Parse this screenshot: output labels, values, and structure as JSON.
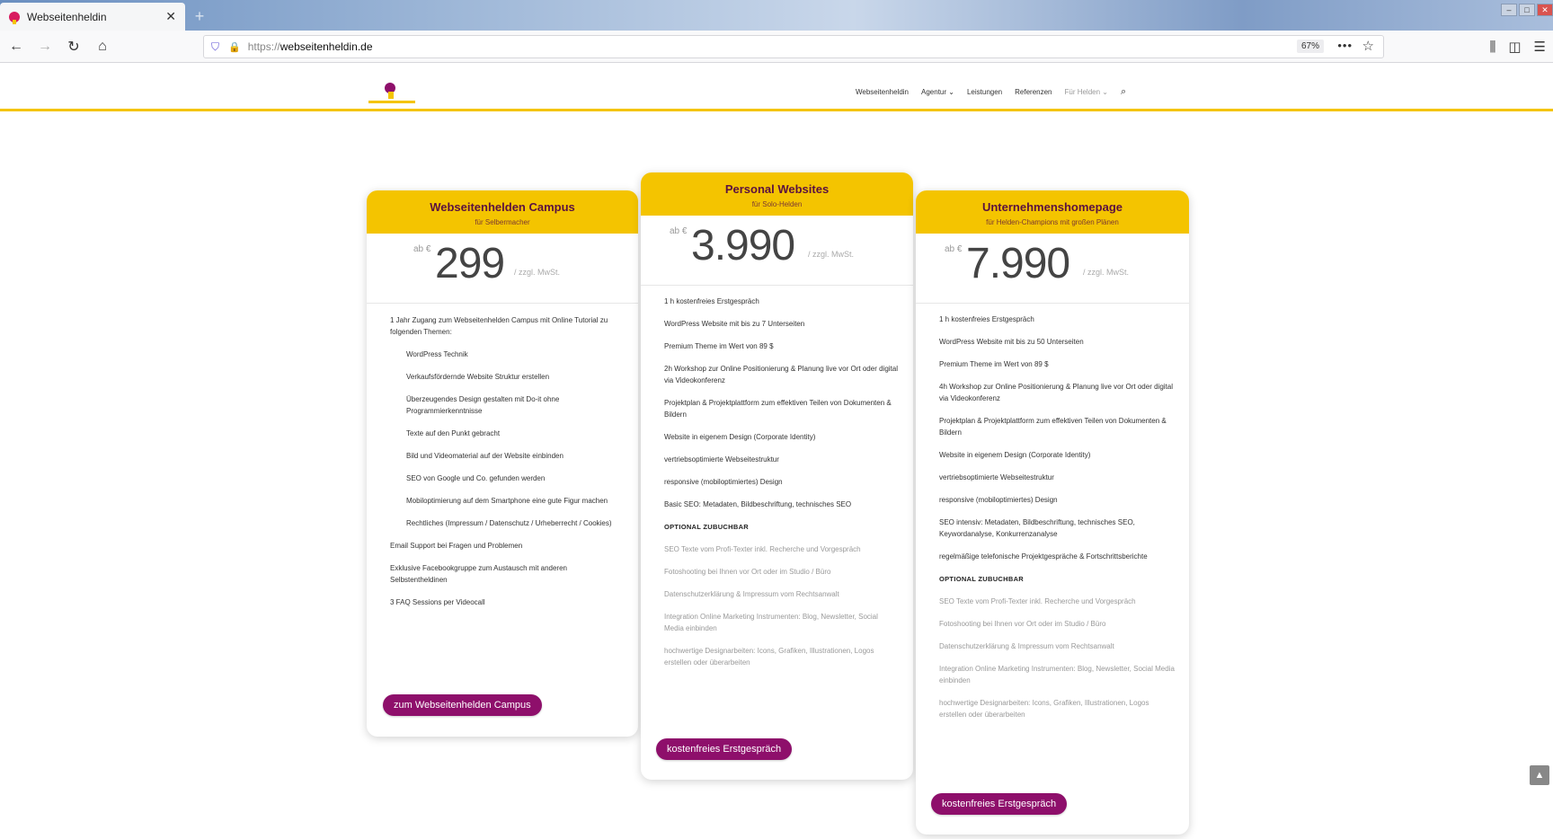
{
  "browser": {
    "tab_title": "Webseitenheldin",
    "tab_close": "✕",
    "url_protocol": "https://",
    "url_host": "webseitenheldin.de",
    "zoom": "67%",
    "menu_dots": "•••"
  },
  "site_nav": {
    "items": [
      "Webseitenheldin",
      "Agentur ⌄",
      "Leistungen",
      "Referenzen",
      "Für Helden ⌄"
    ]
  },
  "cards": [
    {
      "title": "Webseitenhelden Campus",
      "subtitle": "für Selbermacher",
      "price_prefix": "ab €",
      "price": "299",
      "price_suffix": "/ zzgl. MwSt.",
      "features": [
        "1 Jahr Zugang zum Webseitenhelden Campus mit Online Tutorial zu folgenden Themen:",
        "WordPress Technik",
        "Verkaufsfördernde Website Struktur erstellen",
        "Überzeugendes Design gestalten mit Do-it ohne Programmierkenntnisse",
        "Texte auf den Punkt gebracht",
        "Bild und Videomaterial auf der Website einbinden",
        "SEO von Google und Co. gefunden werden",
        "Mobiloptimierung auf dem Smartphone eine gute Figur machen",
        "Rechtliches (Impressum / Datenschutz / Urheberrecht / Cookies)",
        "Email Support bei Fragen und Problemen",
        "Exklusive Facebookgruppe zum Austausch mit anderen Selbstentheldinen",
        "3 FAQ Sessions per Videocall"
      ],
      "cta": "zum Webseitenhelden Campus"
    },
    {
      "title": "Personal Websites",
      "subtitle": "für Solo-Helden",
      "price_prefix": "ab €",
      "price": "3.990",
      "price_suffix": "/ zzgl. MwSt.",
      "features": [
        "1 h kostenfreies Erstgespräch",
        "WordPress Website mit bis zu 7 Unterseiten",
        "Premium Theme im Wert von 89 $",
        "2h Workshop zur Online Positionierung & Planung live vor Ort oder digital via Videokonferenz",
        "Projektplan & Projektplattform zum effektiven Teilen von Dokumenten & Bildern",
        "Website in eigenem Design (Corporate Identity)",
        "vertriebsoptimierte Webseitestruktur",
        "responsive (mobiloptimiertes) Design",
        "Basic SEO: Metadaten, Bildbeschriftung, technisches SEO"
      ],
      "optional_heading": "OPTIONAL ZUBUCHBAR",
      "optional": [
        "SEO Texte vom Profi-Texter inkl. Recherche und Vorgespräch",
        "Fotoshooting bei Ihnen vor Ort oder im Studio / Büro",
        "Datenschutzerklärung & Impressum vom Rechtsanwalt",
        "Integration Online Marketing Instrumenten: Blog, Newsletter, Social Media einbinden",
        "hochwertige Designarbeiten: Icons, Grafiken, Illustrationen, Logos erstellen oder überarbeiten"
      ],
      "cta": "kostenfreies Erstgespräch"
    },
    {
      "title": "Unternehmenshomepage",
      "subtitle": "für Helden-Champions mit großen Plänen",
      "price_prefix": "ab €",
      "price": "7.990",
      "price_suffix": "/ zzgl. MwSt.",
      "features": [
        "1 h kostenfreies Erstgespräch",
        "WordPress Website mit bis zu 50 Unterseiten",
        "Premium Theme im Wert von 89 $",
        "4h Workshop zur Online Positionierung & Planung live vor Ort oder digital via Videokonferenz",
        "Projektplan & Projektplattform zum effektiven Teilen von Dokumenten & Bildern",
        "Website in eigenem Design (Corporate Identity)",
        "vertriebsoptimierte Webseitestruktur",
        "responsive (mobiloptimiertes) Design",
        "SEO intensiv: Metadaten, Bildbeschriftung, technisches SEO, Keywordanalyse, Konkurrenzanalyse",
        "regelmäßige telefonische Projektgespräche & Fortschrittsberichte"
      ],
      "optional_heading": "OPTIONAL ZUBUCHBAR",
      "optional": [
        "SEO Texte vom Profi-Texter inkl. Recherche und Vorgespräch",
        "Fotoshooting bei Ihnen vor Ort oder im Studio / Büro",
        "Datenschutzerklärung & Impressum vom Rechtsanwalt",
        "Integration Online Marketing Instrumenten: Blog, Newsletter, Social Media einbinden",
        "hochwertige Designarbeiten: Icons, Grafiken, Illustrationen, Logos erstellen oder überarbeiten"
      ],
      "cta": "kostenfreies Erstgespräch"
    }
  ],
  "colors": {
    "accent_yellow": "#f4c400",
    "brand_purple": "#8e0f6b"
  }
}
